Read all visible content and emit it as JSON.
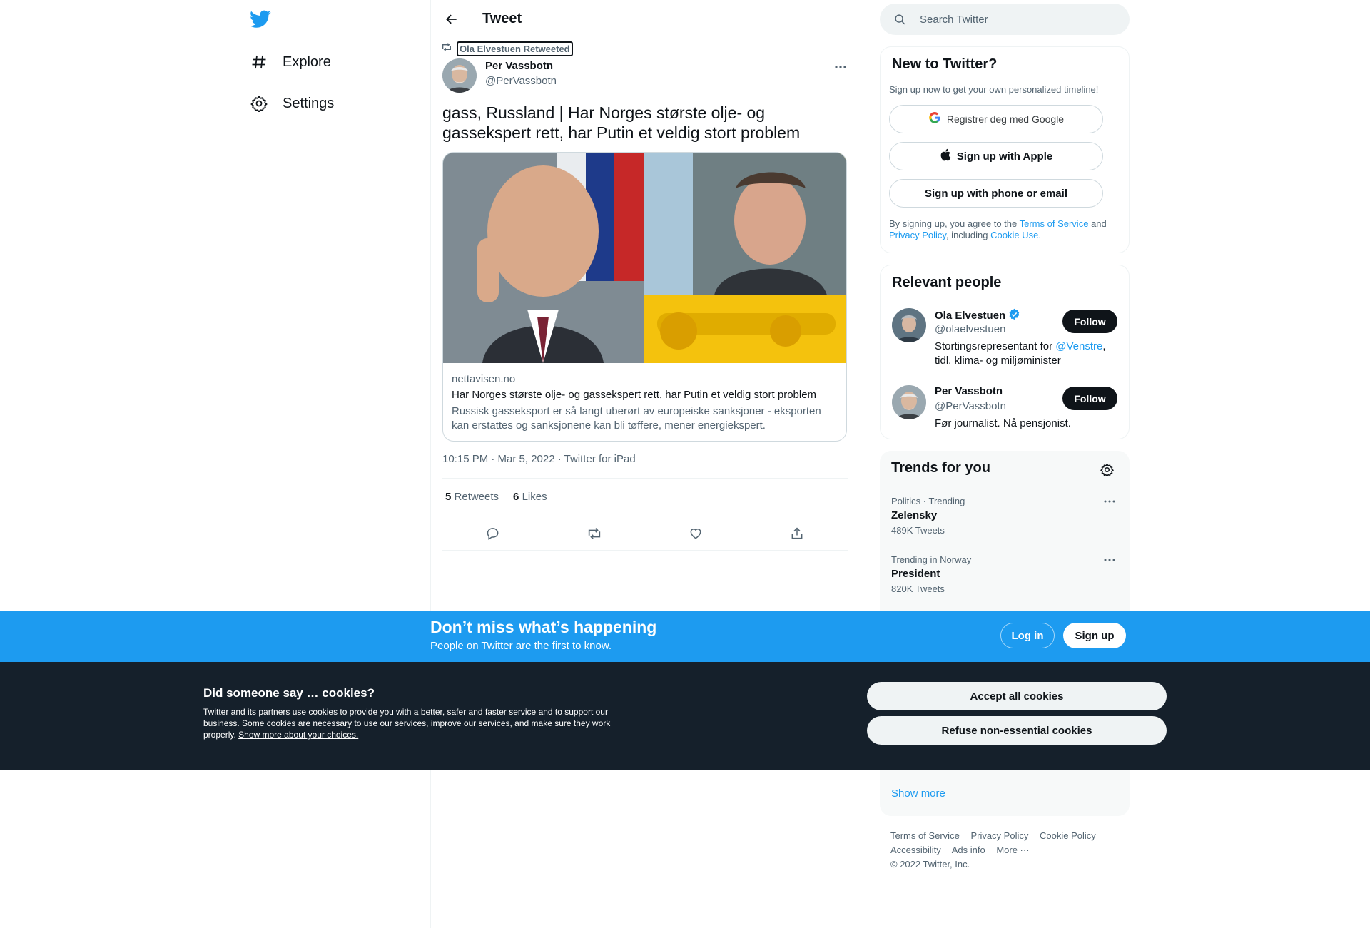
{
  "nav": {
    "items": [
      {
        "label": "Explore"
      },
      {
        "label": "Settings"
      }
    ]
  },
  "header": {
    "title": "Tweet"
  },
  "tweet": {
    "retweeted_by": "Ola Elvestuen Retweeted",
    "author_name": "Per Vassbotn",
    "author_handle": "@PerVassbotn",
    "text": "gass, Russland | Har Norges største olje- og gassekspert rett, har Putin et veldig stort problem",
    "card": {
      "domain": "nettavisen.no",
      "title": "Har Norges største olje- og gassekspert rett, har Putin et veldig stort problem",
      "description": "Russisk gasseksport er så langt uberørt av europeiske sanksjoner - eksporten kan erstattes og sanksjonene kan bli tøffere, mener energiekspert."
    },
    "meta": "10:15 PM · Mar 5, 2022 · Twitter for iPad",
    "retweets_count": "5",
    "retweets_label": "Retweets",
    "likes_count": "6",
    "likes_label": "Likes",
    "actions": [
      "reply-icon",
      "retweet-icon",
      "like-icon",
      "share-icon"
    ]
  },
  "search": {
    "placeholder": "Search Twitter"
  },
  "signup_box": {
    "title": "New to Twitter?",
    "subtitle": "Sign up now to get your own personalized timeline!",
    "google_label": "Registrer deg med Google",
    "apple_label": "Sign up with Apple",
    "phone_label": "Sign up with phone or email",
    "terms_prefix": "By signing up, you agree to the",
    "terms_link": "Terms of Service",
    "terms_and": "and",
    "privacy_link": "Privacy Policy",
    "terms_including": ", including",
    "cookie_link": "Cookie Use."
  },
  "relevant_people": {
    "title": "Relevant people",
    "people": [
      {
        "name": "Ola Elvestuen",
        "handle": "@olaelvestuen",
        "verified": true,
        "bio_prefix": "Stortingsrepresentant for",
        "bio_mention": "@Venstre",
        "bio_suffix": ", tidl. klima- og miljøminister",
        "follow_label": "Follow"
      },
      {
        "name": "Per Vassbotn",
        "handle": "@PerVassbotn",
        "verified": false,
        "bio": "Før journalist. Nå pensjonist.",
        "follow_label": "Follow"
      }
    ]
  },
  "trends": {
    "title": "Trends for you",
    "items": [
      {
        "context": "Politics · Trending",
        "name": "Zelensky",
        "count": "489K Tweets"
      },
      {
        "context": "Trending in Norway",
        "name": "President",
        "count": "820K Tweets"
      }
    ],
    "show_more": "Show more"
  },
  "footer": {
    "links": [
      "Terms of Service",
      "Privacy Policy",
      "Cookie Policy",
      "Accessibility",
      "Ads info",
      "More ···"
    ],
    "copyright": "© 2022 Twitter, Inc."
  },
  "bottom_bar": {
    "title": "Don’t miss what’s happening",
    "subtitle": "People on Twitter are the first to know.",
    "login_label": "Log in",
    "signup_label": "Sign up"
  },
  "cookie_banner": {
    "title": "Did someone say … cookies?",
    "text": "Twitter and its partners use cookies to provide you with a better, safer and faster service and to support our business. Some cookies are necessary to use our services, improve our services, and make sure they work properly.",
    "link": "Show more about your choices.",
    "accept_label": "Accept all cookies",
    "refuse_label": "Refuse non-essential cookies"
  },
  "colors": {
    "accent": "#1d9bf0",
    "text": "#0f1419",
    "muted": "#536471",
    "cookie_bg": "#15202b"
  }
}
